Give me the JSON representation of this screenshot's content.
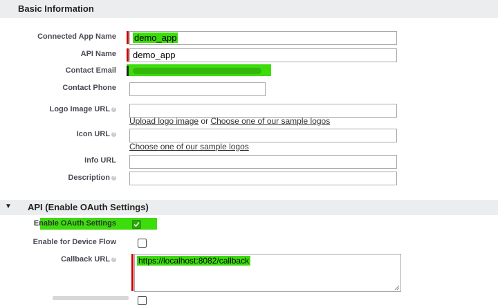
{
  "basic": {
    "title": "Basic Information",
    "connected_app_name_label": "Connected App Name",
    "connected_app_name_value": "demo_app",
    "api_name_label": "API Name",
    "api_name_value": "demo_app",
    "contact_email_label": "Contact Email",
    "contact_phone_label": "Contact Phone",
    "logo_image_url_label": "Logo Image URL",
    "upload_logo_link": "Upload logo image",
    "or_text": "or",
    "sample_logos_link": "Choose one of our sample logos",
    "icon_url_label": "Icon URL",
    "icon_sample_logos_link": "Choose one of our sample logos",
    "info_url_label": "Info URL",
    "description_label": "Description"
  },
  "api": {
    "title": "API (Enable OAuth Settings)",
    "enable_oauth_label": "Enable OAuth Settings",
    "enable_oauth_checked": true,
    "device_flow_label": "Enable for Device Flow",
    "device_flow_checked": false,
    "callback_url_label": "Callback URL",
    "callback_url_value": "https://localhost:8082/callback"
  },
  "colors": {
    "highlight": "#3ddc0c",
    "required": "#cc0000",
    "header_bg": "#ecedee"
  }
}
